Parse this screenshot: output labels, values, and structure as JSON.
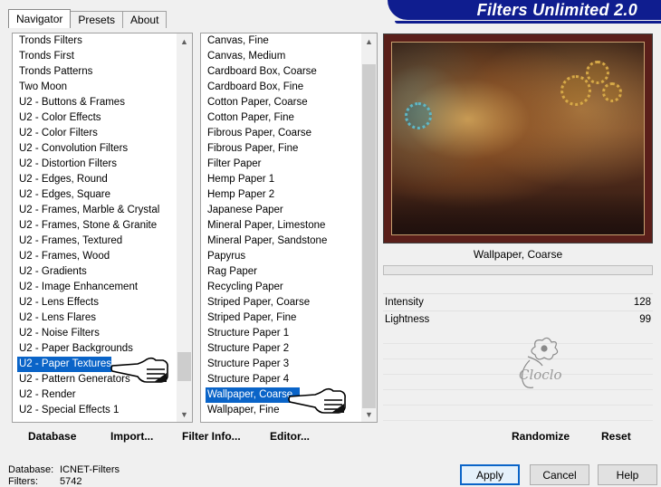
{
  "brand": {
    "title": "Filters Unlimited 2.0"
  },
  "tabs": [
    {
      "label": "Navigator",
      "active": true
    },
    {
      "label": "Presets",
      "active": false
    },
    {
      "label": "About",
      "active": false
    }
  ],
  "categories": {
    "items": [
      "Tronds Filters",
      "Tronds First",
      "Tronds Patterns",
      "Two Moon",
      "U2 - Buttons & Frames",
      "U2 - Color Effects",
      "U2 - Color Filters",
      "U2 - Convolution Filters",
      "U2 - Distortion Filters",
      "U2 - Edges, Round",
      "U2 - Edges, Square",
      "U2 - Frames, Marble & Crystal",
      "U2 - Frames, Stone & Granite",
      "U2 - Frames, Textured",
      "U2 - Frames, Wood",
      "U2 - Gradients",
      "U2 - Image Enhancement",
      "U2 - Lens Effects",
      "U2 - Lens Flares",
      "U2 - Noise Filters",
      "U2 - Paper Backgrounds",
      "U2 - Paper Textures",
      "U2 - Pattern Generators",
      "U2 - Render",
      "U2 - Special Effects 1"
    ],
    "selected": "U2 - Paper Textures"
  },
  "filters": {
    "items": [
      "Canvas, Fine",
      "Canvas, Medium",
      "Cardboard Box, Coarse",
      "Cardboard Box, Fine",
      "Cotton Paper, Coarse",
      "Cotton Paper, Fine",
      "Fibrous Paper, Coarse",
      "Fibrous Paper, Fine",
      "Filter Paper",
      "Hemp Paper 1",
      "Hemp Paper 2",
      "Japanese Paper",
      "Mineral Paper, Limestone",
      "Mineral Paper, Sandstone",
      "Papyrus",
      "Rag Paper",
      "Recycling Paper",
      "Striped Paper, Coarse",
      "Striped Paper, Fine",
      "Structure Paper 1",
      "Structure Paper 2",
      "Structure Paper 3",
      "Structure Paper 4",
      "Wallpaper, Coarse",
      "Wallpaper, Fine"
    ],
    "selected": "Wallpaper, Coarse"
  },
  "preview": {
    "caption": "Wallpaper, Coarse"
  },
  "params": [
    {
      "label": "Intensity",
      "value": "128"
    },
    {
      "label": "Lightness",
      "value": "99"
    }
  ],
  "watermark": {
    "text": "Cloclo"
  },
  "toolbar": {
    "database": "Database",
    "import": "Import...",
    "filter_info": "Filter Info...",
    "editor": "Editor...",
    "randomize": "Randomize",
    "reset": "Reset"
  },
  "footer": {
    "database_label": "Database:",
    "database_value": "ICNET-Filters",
    "filters_label": "Filters:",
    "filters_value": "5742"
  },
  "buttons": {
    "apply": "Apply",
    "cancel": "Cancel",
    "help": "Help"
  },
  "icons": {
    "scroll_up": "chevron-up-icon",
    "scroll_down": "chevron-down-icon",
    "pointer": "pointing-hand-icon"
  },
  "colors": {
    "brand": "#0f1d8f",
    "selection": "#0a64c8"
  }
}
